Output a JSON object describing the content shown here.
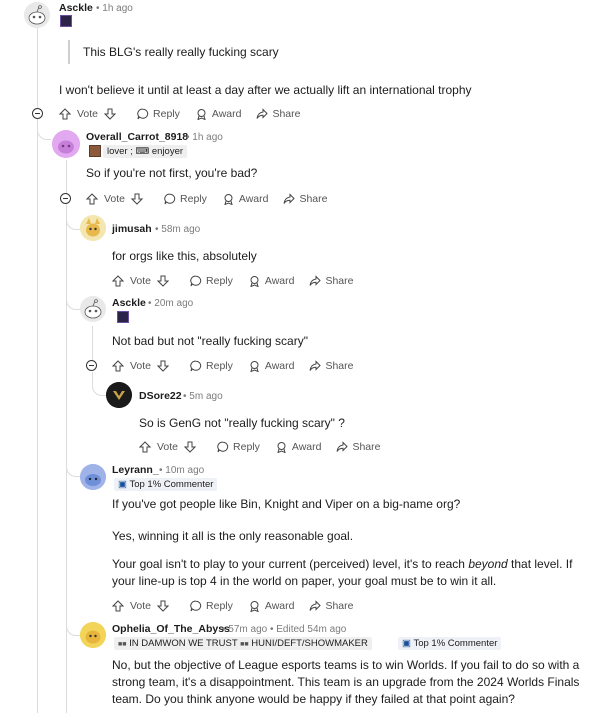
{
  "actions": {
    "vote": "Vote",
    "reply": "Reply",
    "award": "Award",
    "share": "Share"
  },
  "comments": [
    {
      "user": "Asckle",
      "time": "1h ago",
      "quote": "This BLG's really really fucking scary",
      "body": "I won't believe it until at least a day after we actually lift an international trophy"
    },
    {
      "user": "Overall_Carrot_8918",
      "time": "1h ago",
      "flair": "lover ; ⌨ enjoyer",
      "body": "So if you're not first, you're bad?"
    },
    {
      "user": "jimusah",
      "time": "58m ago",
      "body": "for orgs like this, absolutely"
    },
    {
      "user": "Asckle",
      "time": "20m ago",
      "body": "Not bad but not \"really fucking scary\""
    },
    {
      "user": "DSore22",
      "time": "5m ago",
      "body": "So is GenG not \"really fucking scary\" ?"
    },
    {
      "user": "Leyrann_",
      "time": "10m ago",
      "flair": "Top 1% Commenter",
      "body1": "If you've got people like Bin, Knight and Viper on a big-name org?",
      "body2": "Yes, winning it all is the only reasonable goal.",
      "body3a": "Your goal isn't to play to your current (perceived) level, it's to reach ",
      "body3b": "beyond",
      "body3c": " that level. If your line-up is top 4 in the world on paper, your goal must be to win it all."
    },
    {
      "user": "Ophelia_Of_The_Abyss",
      "time": "57m ago",
      "edited": "Edited 54m ago",
      "flair1": "IN DAMWON WE TRUST",
      "flair2": "HUNI/DEFT/SHOWMAKER",
      "flair3": "Top 1% Commenter",
      "body": "No, but the objective of League esports teams is to win Worlds. If you fail to do so with a strong team, it's a disappointment. This team is an upgrade from the 2024 Worlds Finals team. Do you think anyone would be happy if they failed at that point again?"
    }
  ],
  "colors": {
    "meta": "#7c7c7c",
    "line": "#dcdcdc",
    "accent": "#1a4f9c"
  }
}
